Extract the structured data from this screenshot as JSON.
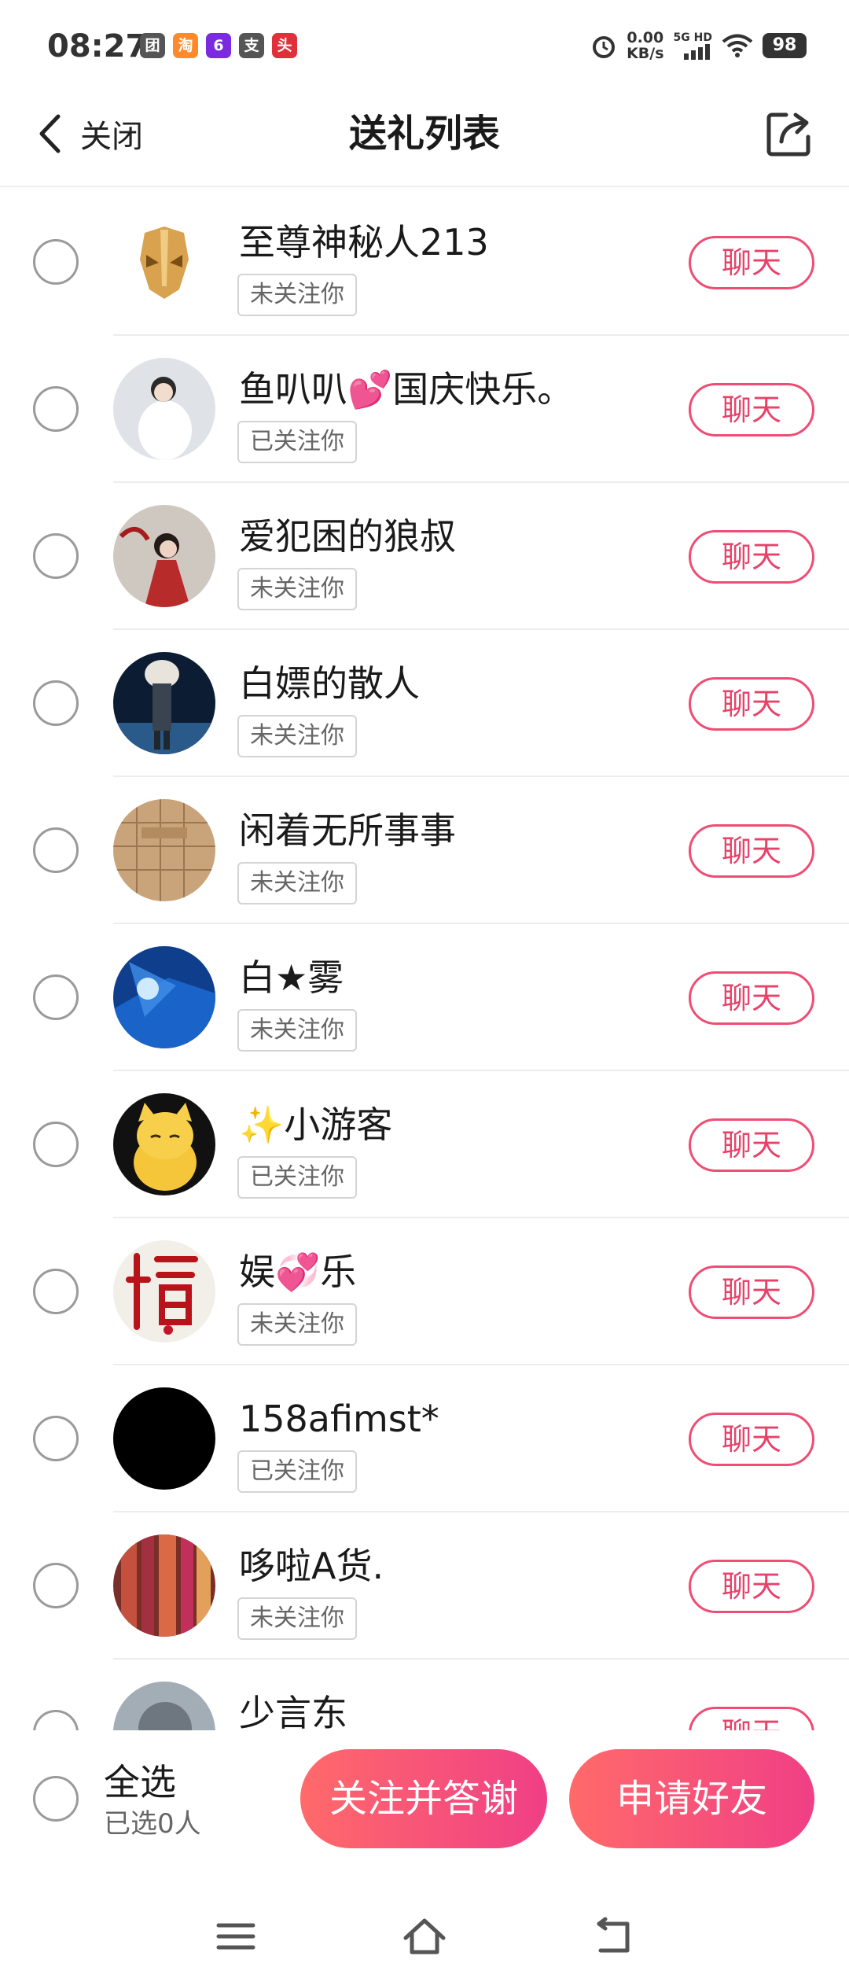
{
  "status": {
    "time": "08:27",
    "apps": [
      {
        "label": "团",
        "color": "#555555"
      },
      {
        "label": "淘",
        "color": "#ff8a2a"
      },
      {
        "label": "6",
        "color": "#7a2be0"
      },
      {
        "label": "支",
        "color": "#555555"
      },
      {
        "label": "头",
        "color": "#e0303a"
      }
    ],
    "net_speed_value": "0.00",
    "net_speed_unit": "KB/s",
    "network_gen": "5G HD",
    "battery": "98"
  },
  "header": {
    "back_label": "关闭",
    "title": "送礼列表"
  },
  "follow_tags": {
    "not_following": "未关注你",
    "following": "已关注你"
  },
  "chat_label": "聊天",
  "users": [
    {
      "name": "至尊神秘人213",
      "tag": "未关注你"
    },
    {
      "name": "鱼叭叭💕国庆快乐。",
      "tag": "已关注你"
    },
    {
      "name": "爱犯困的狼叔",
      "tag": "未关注你"
    },
    {
      "name": "白嫖的散人",
      "tag": "未关注你"
    },
    {
      "name": "闲着无所事事",
      "tag": "未关注你"
    },
    {
      "name": "白★雾",
      "tag": "未关注你"
    },
    {
      "name": "✨小游客",
      "tag": "已关注你"
    },
    {
      "name": "娱💞乐",
      "tag": "未关注你"
    },
    {
      "name": "158afimst*",
      "tag": "已关注你"
    },
    {
      "name": "哆啦A货.",
      "tag": "未关注你"
    },
    {
      "name": "少言东",
      "tag": ""
    }
  ],
  "avatar_colors": [
    "#d9a85b",
    "#d7dbe1",
    "#a8453f",
    "#0b1c33",
    "#c9a47a",
    "#1a63c9",
    "#1a1208",
    "#f2efe8",
    "#000000",
    "#b2483c",
    "#8f99a3"
  ],
  "bottom": {
    "select_all": "全选",
    "selected_count": "已选0人",
    "follow_thank": "关注并答谢",
    "apply_friend": "申请好友"
  }
}
